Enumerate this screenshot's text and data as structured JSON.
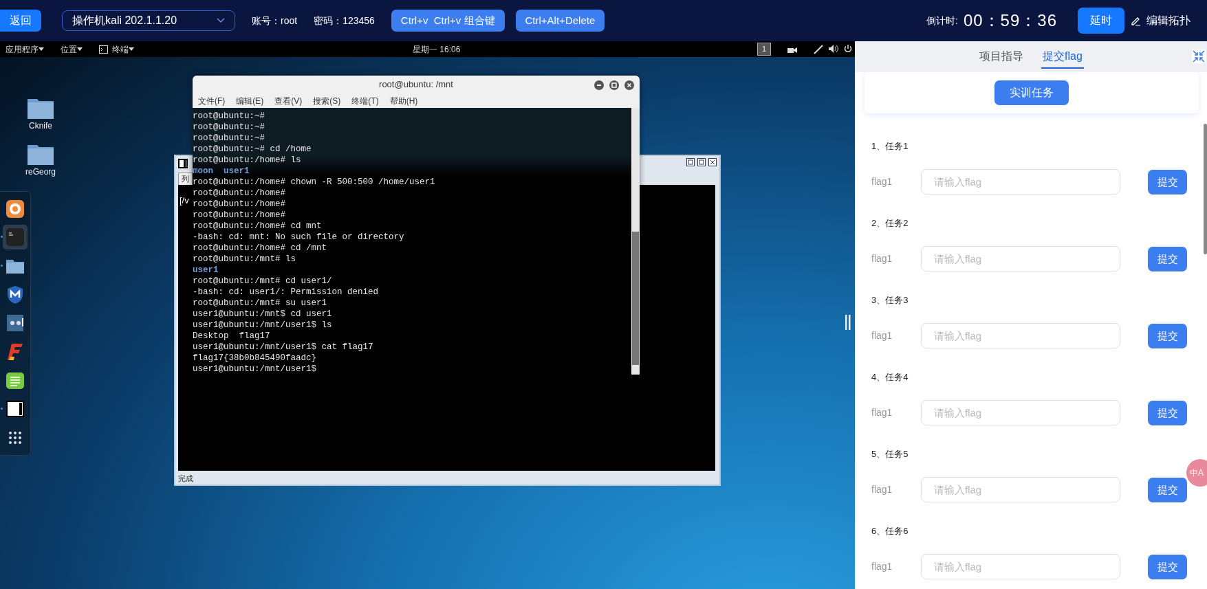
{
  "topbar": {
    "back_button": "返回",
    "machine_select": "操作机kali 202.1.1.20",
    "account": "账号：root",
    "password": "密码：123456",
    "buttons": [
      "Ctrl+v  Ctrl+v 组合键",
      "Ctrl+Alt+Delete"
    ],
    "countdown_label": "倒计时:",
    "countdown": "00：59：36",
    "delay_button": "延时",
    "edit_topology": "编辑拓扑"
  },
  "desktop": {
    "panel": {
      "menus": [
        {
          "label": "应用程序",
          "kind": "plain"
        },
        {
          "label": "位置",
          "kind": "plain"
        },
        {
          "label": "终端",
          "kind": "terminal"
        }
      ],
      "clock": "星期一 16:06",
      "workspace": "1"
    },
    "icons": [
      {
        "label": "Cknife"
      },
      {
        "label": "reGeorg"
      }
    ],
    "dock": [
      {
        "kind": "browser",
        "running": false,
        "selected": false
      },
      {
        "kind": "terminal",
        "running": true,
        "selected": true
      },
      {
        "kind": "folder",
        "running": true,
        "selected": false
      },
      {
        "kind": "shield",
        "running": false,
        "selected": false
      },
      {
        "kind": "cat",
        "running": false,
        "selected": false
      },
      {
        "kind": "flash",
        "running": false,
        "selected": false
      },
      {
        "kind": "notes",
        "running": false,
        "selected": false
      },
      {
        "kind": "window",
        "running": true,
        "selected": false
      },
      {
        "kind": "apps",
        "running": false,
        "selected": false
      }
    ],
    "background_window": {
      "tab": "列",
      "text": "[/v",
      "status": "完成"
    },
    "terminal": {
      "title": "root@ubuntu: /mnt",
      "menu": [
        "文件(F)",
        "编辑(E)",
        "查看(V)",
        "搜索(S)",
        "终端(T)",
        "帮助(H)"
      ],
      "lines": [
        {
          "text": "root@ubuntu:~#",
          "kind": "out"
        },
        {
          "text": "root@ubuntu:~#",
          "kind": "out"
        },
        {
          "text": "root@ubuntu:~#",
          "kind": "out"
        },
        {
          "text": "root@ubuntu:~# cd /home",
          "kind": "out"
        },
        {
          "text": "root@ubuntu:/home# ls",
          "kind": "out"
        },
        {
          "text": "moon  user1",
          "kind": "dir"
        },
        {
          "text": "root@ubuntu:/home# chown -R 500:500 /home/user1",
          "kind": "out"
        },
        {
          "text": "root@ubuntu:/home#",
          "kind": "out"
        },
        {
          "text": "root@ubuntu:/home#",
          "kind": "out"
        },
        {
          "text": "root@ubuntu:/home#",
          "kind": "out"
        },
        {
          "text": "root@ubuntu:/home# cd mnt",
          "kind": "out"
        },
        {
          "text": "-bash: cd: mnt: No such file or directory",
          "kind": "out"
        },
        {
          "text": "root@ubuntu:/home# cd /mnt",
          "kind": "out"
        },
        {
          "text": "root@ubuntu:/mnt# ls",
          "kind": "out"
        },
        {
          "text": "user1",
          "kind": "dir"
        },
        {
          "text": "root@ubuntu:/mnt# cd user1/",
          "kind": "out"
        },
        {
          "text": "-bash: cd: user1/: Permission denied",
          "kind": "out"
        },
        {
          "text": "root@ubuntu:/mnt# su user1",
          "kind": "out"
        },
        {
          "text": "user1@ubuntu:/mnt$ cd user1",
          "kind": "out"
        },
        {
          "text": "user1@ubuntu:/mnt/user1$ ls",
          "kind": "out"
        },
        {
          "text": "Desktop  flag17",
          "kind": "out"
        },
        {
          "text": "user1@ubuntu:/mnt/user1$ cat flag17",
          "kind": "out"
        },
        {
          "text": "flag17{38b0b845490faadc}",
          "kind": "out"
        },
        {
          "text": "user1@ubuntu:/mnt/user1$",
          "kind": "out"
        }
      ]
    }
  },
  "panel": {
    "tabs": [
      {
        "label": "项目指导",
        "selected": false
      },
      {
        "label": "提交flag",
        "selected": true
      }
    ],
    "task_button": "实训任务",
    "tasks": [
      {
        "title": "1、任务1",
        "label": "flag1",
        "placeholder": "请输入flag",
        "submit": "提交"
      },
      {
        "title": "2、任务2",
        "label": "flag1",
        "placeholder": "请输入flag",
        "submit": "提交"
      },
      {
        "title": "3、任务3",
        "label": "flag1",
        "placeholder": "请输入flag",
        "submit": "提交"
      },
      {
        "title": "4、任务4",
        "label": "flag1",
        "placeholder": "请输入flag",
        "submit": "提交"
      },
      {
        "title": "5、任务5",
        "label": "flag1",
        "placeholder": "请输入flag",
        "submit": "提交"
      },
      {
        "title": "6、任务6",
        "label": "flag1",
        "placeholder": "请输入flag",
        "submit": "提交"
      }
    ],
    "ime_badge": "中A"
  }
}
